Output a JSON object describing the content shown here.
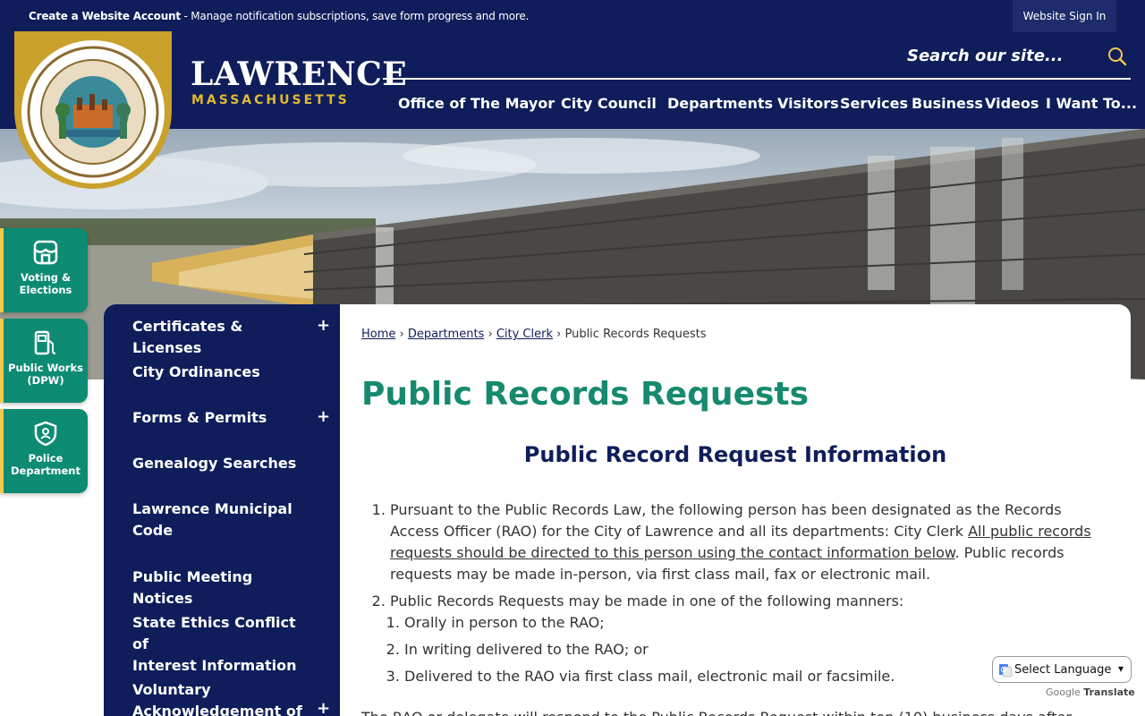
{
  "topbar": {
    "account_bold": "Create a Website Account",
    "account_text": " - Manage notification subscriptions, save form progress and more.",
    "signin": "Website Sign In"
  },
  "brand": {
    "name": "LAWRENCE",
    "state": "MASSACHUSETTS"
  },
  "search": {
    "placeholder": "Search our site..."
  },
  "nav": [
    "Office of The Mayor",
    "City Council",
    "Departments",
    "Visitors",
    "Services",
    "Business",
    "Videos",
    "I Want To..."
  ],
  "quick_links": [
    {
      "label_1": "Voting &",
      "label_2": "Elections",
      "icon": "storefront-icon"
    },
    {
      "label_1": "Public Works",
      "label_2": "(DPW)",
      "icon": "fuel-pump-icon"
    },
    {
      "label_1": "Police",
      "label_2": "Department",
      "icon": "shield-icon"
    }
  ],
  "sidenav": [
    {
      "line1": "Certificates & Licenses",
      "line2": "",
      "expandable": true
    },
    {
      "line1": "City Ordinances",
      "line2": "",
      "expandable": false
    },
    {
      "line1": "Forms & Permits",
      "line2": "",
      "expandable": true
    },
    {
      "line1": "Genealogy Searches",
      "line2": "",
      "expandable": false
    },
    {
      "line1": "Lawrence Municipal",
      "line2": "Code",
      "expandable": false
    },
    {
      "line1": "Public Meeting Notices",
      "line2": "",
      "expandable": false
    },
    {
      "line1": "State Ethics Conflict of",
      "line2": "Interest Information",
      "expandable": false
    },
    {
      "line1": "Voluntary",
      "line2": "Acknowledgement of",
      "expandable": true
    }
  ],
  "breadcrumb": {
    "home": "Home",
    "departments": "Departments",
    "city_clerk": "City Clerk",
    "current": "Public Records Requests"
  },
  "page": {
    "title": "Public Records Requests",
    "subtitle": "Public Record Request Information",
    "item1_a": "Pursuant to the Public Records Law, the following person has been designated as the Records Access Officer (RAO) for the City of Lawrence and all its departments: City Clerk ",
    "item1_link": "All public records requests should be directed to this person using the contact information below",
    "item1_b": ". Public records requests may be made in-person, via first class mail, fax or electronic mail.",
    "item2": "Public Records Requests may be made in one of the following manners:",
    "sub1": "Orally in person to the RAO;",
    "sub2": "In writing delivered to the RAO; or",
    "sub3": "Delivered to the RAO via first class mail, electronic mail or facsimile.",
    "cutoff": "The RAO or delegate will respond to the Public Records Request within ten (10) business days after"
  },
  "translate": {
    "select": "Select Language",
    "google": "Google",
    "translate": "Translate"
  }
}
